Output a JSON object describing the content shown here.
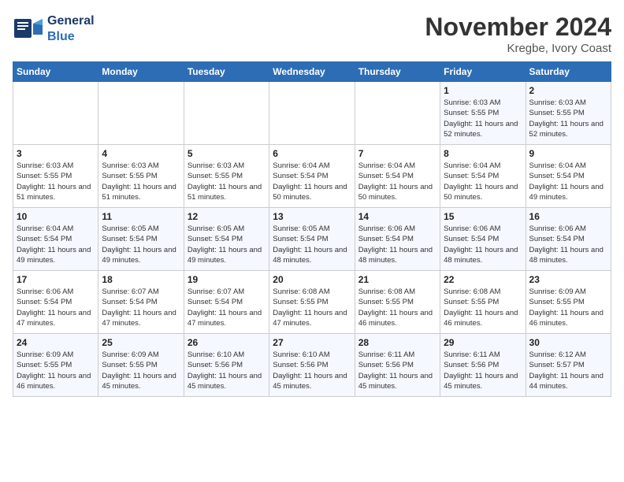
{
  "header": {
    "logo_text": "General Blue",
    "month_title": "November 2024",
    "location": "Kregbe, Ivory Coast"
  },
  "weekdays": [
    "Sunday",
    "Monday",
    "Tuesday",
    "Wednesday",
    "Thursday",
    "Friday",
    "Saturday"
  ],
  "weeks": [
    [
      {
        "day": "",
        "empty": true
      },
      {
        "day": "",
        "empty": true
      },
      {
        "day": "",
        "empty": true
      },
      {
        "day": "",
        "empty": true
      },
      {
        "day": "",
        "empty": true
      },
      {
        "day": "1",
        "sunrise": "6:03 AM",
        "sunset": "5:55 PM",
        "daylight": "11 hours and 52 minutes."
      },
      {
        "day": "2",
        "sunrise": "6:03 AM",
        "sunset": "5:55 PM",
        "daylight": "11 hours and 52 minutes."
      }
    ],
    [
      {
        "day": "3",
        "sunrise": "6:03 AM",
        "sunset": "5:55 PM",
        "daylight": "11 hours and 51 minutes."
      },
      {
        "day": "4",
        "sunrise": "6:03 AM",
        "sunset": "5:55 PM",
        "daylight": "11 hours and 51 minutes."
      },
      {
        "day": "5",
        "sunrise": "6:03 AM",
        "sunset": "5:55 PM",
        "daylight": "11 hours and 51 minutes."
      },
      {
        "day": "6",
        "sunrise": "6:04 AM",
        "sunset": "5:54 PM",
        "daylight": "11 hours and 50 minutes."
      },
      {
        "day": "7",
        "sunrise": "6:04 AM",
        "sunset": "5:54 PM",
        "daylight": "11 hours and 50 minutes."
      },
      {
        "day": "8",
        "sunrise": "6:04 AM",
        "sunset": "5:54 PM",
        "daylight": "11 hours and 50 minutes."
      },
      {
        "day": "9",
        "sunrise": "6:04 AM",
        "sunset": "5:54 PM",
        "daylight": "11 hours and 49 minutes."
      }
    ],
    [
      {
        "day": "10",
        "sunrise": "6:04 AM",
        "sunset": "5:54 PM",
        "daylight": "11 hours and 49 minutes."
      },
      {
        "day": "11",
        "sunrise": "6:05 AM",
        "sunset": "5:54 PM",
        "daylight": "11 hours and 49 minutes."
      },
      {
        "day": "12",
        "sunrise": "6:05 AM",
        "sunset": "5:54 PM",
        "daylight": "11 hours and 49 minutes."
      },
      {
        "day": "13",
        "sunrise": "6:05 AM",
        "sunset": "5:54 PM",
        "daylight": "11 hours and 48 minutes."
      },
      {
        "day": "14",
        "sunrise": "6:06 AM",
        "sunset": "5:54 PM",
        "daylight": "11 hours and 48 minutes."
      },
      {
        "day": "15",
        "sunrise": "6:06 AM",
        "sunset": "5:54 PM",
        "daylight": "11 hours and 48 minutes."
      },
      {
        "day": "16",
        "sunrise": "6:06 AM",
        "sunset": "5:54 PM",
        "daylight": "11 hours and 48 minutes."
      }
    ],
    [
      {
        "day": "17",
        "sunrise": "6:06 AM",
        "sunset": "5:54 PM",
        "daylight": "11 hours and 47 minutes."
      },
      {
        "day": "18",
        "sunrise": "6:07 AM",
        "sunset": "5:54 PM",
        "daylight": "11 hours and 47 minutes."
      },
      {
        "day": "19",
        "sunrise": "6:07 AM",
        "sunset": "5:54 PM",
        "daylight": "11 hours and 47 minutes."
      },
      {
        "day": "20",
        "sunrise": "6:08 AM",
        "sunset": "5:55 PM",
        "daylight": "11 hours and 47 minutes."
      },
      {
        "day": "21",
        "sunrise": "6:08 AM",
        "sunset": "5:55 PM",
        "daylight": "11 hours and 46 minutes."
      },
      {
        "day": "22",
        "sunrise": "6:08 AM",
        "sunset": "5:55 PM",
        "daylight": "11 hours and 46 minutes."
      },
      {
        "day": "23",
        "sunrise": "6:09 AM",
        "sunset": "5:55 PM",
        "daylight": "11 hours and 46 minutes."
      }
    ],
    [
      {
        "day": "24",
        "sunrise": "6:09 AM",
        "sunset": "5:55 PM",
        "daylight": "11 hours and 46 minutes."
      },
      {
        "day": "25",
        "sunrise": "6:09 AM",
        "sunset": "5:55 PM",
        "daylight": "11 hours and 45 minutes."
      },
      {
        "day": "26",
        "sunrise": "6:10 AM",
        "sunset": "5:56 PM",
        "daylight": "11 hours and 45 minutes."
      },
      {
        "day": "27",
        "sunrise": "6:10 AM",
        "sunset": "5:56 PM",
        "daylight": "11 hours and 45 minutes."
      },
      {
        "day": "28",
        "sunrise": "6:11 AM",
        "sunset": "5:56 PM",
        "daylight": "11 hours and 45 minutes."
      },
      {
        "day": "29",
        "sunrise": "6:11 AM",
        "sunset": "5:56 PM",
        "daylight": "11 hours and 45 minutes."
      },
      {
        "day": "30",
        "sunrise": "6:12 AM",
        "sunset": "5:57 PM",
        "daylight": "11 hours and 44 minutes."
      }
    ]
  ]
}
